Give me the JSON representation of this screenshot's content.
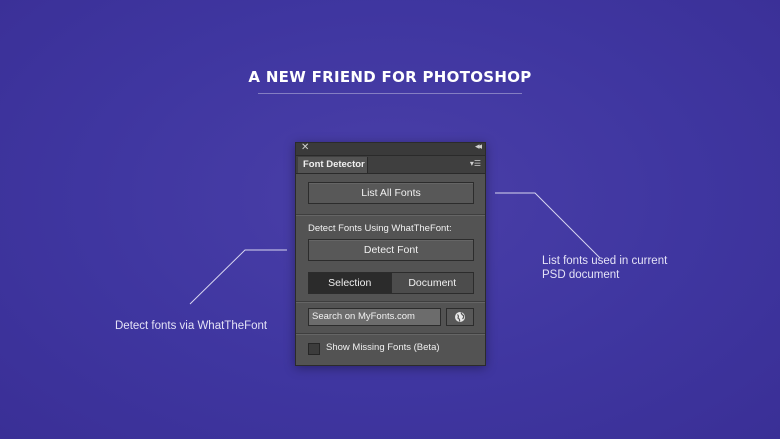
{
  "headline": "A NEW FRIEND FOR PHOTOSHOP",
  "callouts": {
    "left": "Detect fonts via WhatTheFont",
    "right_line1": "List fonts used in current",
    "right_line2": "PSD document"
  },
  "panel": {
    "tab_label": "Font Detector",
    "list_all_button": "List All Fonts",
    "detect_section_label": "Detect Fonts Using WhatTheFont:",
    "detect_button": "Detect Font",
    "scope_options": [
      "Selection",
      "Document"
    ],
    "scope_selected": "Selection",
    "search_value": "Search on MyFonts.com",
    "missing_fonts_label": "Show Missing Fonts (Beta)",
    "missing_fonts_checked": false
  },
  "icons": {
    "close": "close-icon",
    "collapse": "collapse-icon",
    "panel_menu": "panel-menu-icon",
    "search_globe": "globe-icon"
  },
  "colors": {
    "background": "#4138a2",
    "panel": "#535353",
    "text": "#ffffff"
  }
}
